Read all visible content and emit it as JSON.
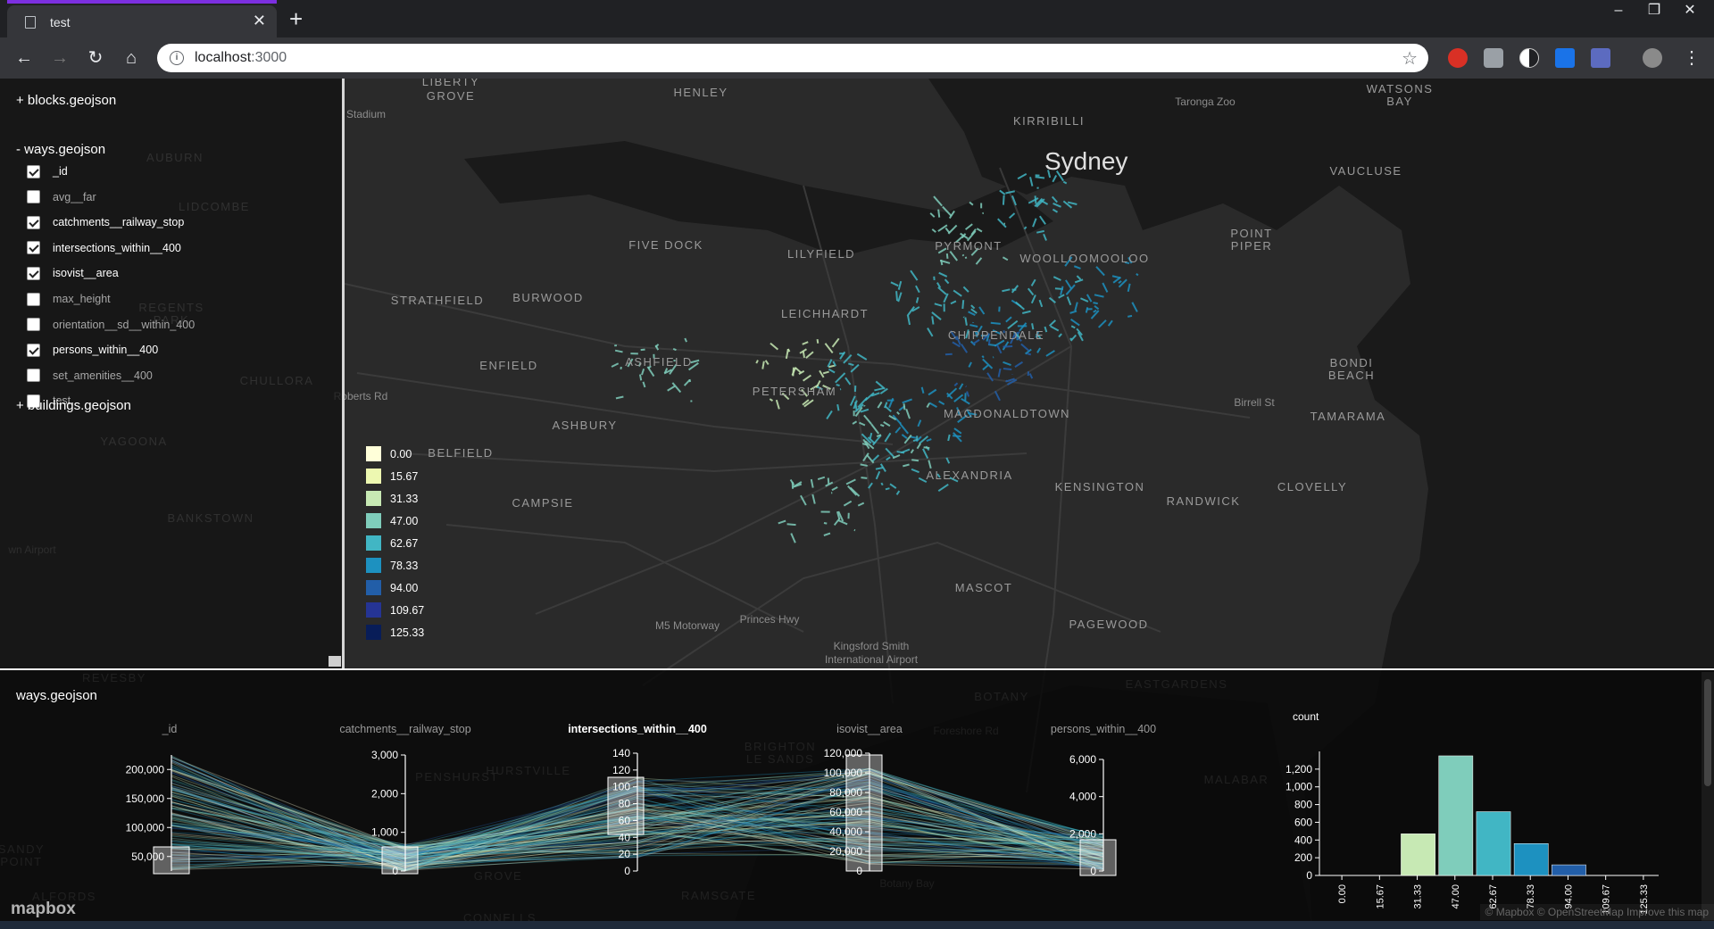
{
  "browser": {
    "tab_title": "test",
    "url_host": "localhost",
    "url_port": ":3000",
    "accent_color": "#7c2fe0"
  },
  "map": {
    "city_label": "Sydney",
    "place_labels": [
      {
        "text": "HENLEY",
        "cls": "sub"
      },
      {
        "text": "KIRRIBILLI",
        "cls": "sub"
      },
      {
        "text": "Taronga Zoo",
        "cls": "poi"
      },
      {
        "text": "WATSONS",
        "cls": "sub"
      },
      {
        "text": "BAY",
        "cls": "sub"
      },
      {
        "text": "VAUCLUSE",
        "cls": "sub"
      },
      {
        "text": "POINT",
        "cls": "sub"
      },
      {
        "text": "PIPER",
        "cls": "sub"
      },
      {
        "text": "FIVE DOCK",
        "cls": "sub"
      },
      {
        "text": "PYRMONT",
        "cls": "sub"
      },
      {
        "text": "WOOLLOOMOOLOO",
        "cls": "sub"
      },
      {
        "text": "LILYFIELD",
        "cls": "sub"
      },
      {
        "text": "STRATHFIELD",
        "cls": "sub"
      },
      {
        "text": "BURWOOD",
        "cls": "sub"
      },
      {
        "text": "LEICHHARDT",
        "cls": "sub"
      },
      {
        "text": "CHIPPENDALE",
        "cls": "sub"
      },
      {
        "text": "BONDI",
        "cls": "sub"
      },
      {
        "text": "BEACH",
        "cls": "sub"
      },
      {
        "text": "ENFIELD",
        "cls": "sub"
      },
      {
        "text": "ASHFIELD",
        "cls": "sub"
      },
      {
        "text": "PETERSHAM",
        "cls": "sub"
      },
      {
        "text": "MACDONALDTOWN",
        "cls": "sub"
      },
      {
        "text": "Birrell St",
        "cls": "poi"
      },
      {
        "text": "TAMARAMA",
        "cls": "sub"
      },
      {
        "text": "ASHBURY",
        "cls": "sub"
      },
      {
        "text": "BELFIELD",
        "cls": "sub"
      },
      {
        "text": "ALEXANDRIA",
        "cls": "sub"
      },
      {
        "text": "KENSINGTON",
        "cls": "sub"
      },
      {
        "text": "RANDWICK",
        "cls": "sub"
      },
      {
        "text": "CLOVELLY",
        "cls": "sub"
      },
      {
        "text": "CAMPSIE",
        "cls": "sub"
      },
      {
        "text": "MASCOT",
        "cls": "sub"
      },
      {
        "text": "PAGEWOOD",
        "cls": "sub"
      },
      {
        "text": "M5 Motorway",
        "cls": "poi"
      },
      {
        "text": "Princes Hwy",
        "cls": "poi"
      },
      {
        "text": "Kingsford Smith",
        "cls": "poi"
      },
      {
        "text": "International Airport",
        "cls": "poi"
      },
      {
        "text": "Roberts Rd",
        "cls": "poi"
      },
      {
        "text": "Stadium",
        "cls": "poi"
      },
      {
        "text": "GROVE",
        "cls": "sub"
      },
      {
        "text": "AUBURN",
        "cls": "sub"
      },
      {
        "text": "LIDCOMBE",
        "cls": "sub"
      },
      {
        "text": "REGENTS",
        "cls": "sub"
      },
      {
        "text": "PARK",
        "cls": "sub"
      },
      {
        "text": "CHULLORA",
        "cls": "sub"
      },
      {
        "text": "YAGOONA",
        "cls": "sub"
      },
      {
        "text": "BANKSTOWN",
        "cls": "sub"
      },
      {
        "text": "wn Airport",
        "cls": "poi"
      },
      {
        "text": "BOTANY",
        "cls": "sub"
      },
      {
        "text": "EASTGARDENS",
        "cls": "sub"
      },
      {
        "text": "MALABAR",
        "cls": "sub"
      },
      {
        "text": "HURSTVILLE",
        "cls": "sub"
      },
      {
        "text": "BRIGHTON",
        "cls": "sub"
      },
      {
        "text": "LE SANDS",
        "cls": "sub"
      },
      {
        "text": "RAMSGATE",
        "cls": "sub"
      },
      {
        "text": "Botany Bay",
        "cls": "poi"
      },
      {
        "text": "Foreshore Rd",
        "cls": "poi"
      },
      {
        "text": "REVESBY",
        "cls": "sub"
      },
      {
        "text": "SANDY",
        "cls": "sub"
      },
      {
        "text": "POINT",
        "cls": "sub"
      },
      {
        "text": "ALFORDS",
        "cls": "sub"
      },
      {
        "text": "PENSHURST",
        "cls": "sub"
      },
      {
        "text": "GROVE",
        "cls": "sub"
      },
      {
        "text": "CONNELLS",
        "cls": "sub"
      },
      {
        "text": "LIBERTY",
        "cls": "sub"
      }
    ]
  },
  "sidebar": {
    "blocks_header": "+ blocks.geojson",
    "ways_header": "- ways.geojson",
    "buildings_header": "+ buildings.geojson",
    "ways_items": [
      {
        "label": "_id",
        "checked": true
      },
      {
        "label": "avg__far",
        "checked": false
      },
      {
        "label": "catchments__railway_stop",
        "checked": true
      },
      {
        "label": "intersections_within__400",
        "checked": true
      },
      {
        "label": "isovist__area",
        "checked": true
      },
      {
        "label": "max_height",
        "checked": false
      },
      {
        "label": "orientation__sd__within_400",
        "checked": false
      },
      {
        "label": "persons_within__400",
        "checked": true
      },
      {
        "label": "set_amenities__400",
        "checked": false
      },
      {
        "label": "test",
        "checked": false
      }
    ]
  },
  "legend": [
    {
      "label": "0.00",
      "color": "#ffffd9"
    },
    {
      "label": "15.67",
      "color": "#edf8b1"
    },
    {
      "label": "31.33",
      "color": "#c7e9b4"
    },
    {
      "label": "47.00",
      "color": "#7fcdbb"
    },
    {
      "label": "62.67",
      "color": "#41b6c4"
    },
    {
      "label": "78.33",
      "color": "#1d91c0"
    },
    {
      "label": "94.00",
      "color": "#225ea8"
    },
    {
      "label": "109.67",
      "color": "#253494"
    },
    {
      "label": "125.33",
      "color": "#081d58"
    }
  ],
  "bottom_panel": {
    "title": "ways.geojson",
    "axes": [
      {
        "name": "_id",
        "highlight": false,
        "ticks": [
          "200,000",
          "150,000",
          "100,000",
          "50,000"
        ]
      },
      {
        "name": "catchments__railway_stop",
        "highlight": false,
        "ticks": [
          "3,000",
          "2,000",
          "1,000",
          "0"
        ]
      },
      {
        "name": "intersections_within__400",
        "highlight": true,
        "ticks": [
          "140",
          "120",
          "100",
          "80",
          "60",
          "40",
          "20",
          "0"
        ]
      },
      {
        "name": "isovist__area",
        "highlight": false,
        "ticks": [
          "120,000",
          "100,000",
          "80,000",
          "60,000",
          "40,000",
          "20,000",
          "0"
        ]
      },
      {
        "name": "persons_within__400",
        "highlight": false,
        "ticks": [
          "6,000",
          "4,000",
          "2,000",
          "0"
        ]
      }
    ],
    "scrollbar": true
  },
  "chart_data": {
    "type": "bar",
    "title": "",
    "ylabel": "count",
    "xlabel": "",
    "categories": [
      "0.00",
      "15.67",
      "31.33",
      "47.00",
      "62.67",
      "78.33",
      "94.00",
      "109.67",
      "125.33"
    ],
    "values": [
      0,
      0,
      470,
      1350,
      720,
      360,
      120,
      0,
      0
    ],
    "colors": [
      "#ffffd9",
      "#edf8b1",
      "#c7e9b4",
      "#7fcdbb",
      "#41b6c4",
      "#1d91c0",
      "#225ea8",
      "#253494",
      "#081d58"
    ],
    "yticks": [
      "0",
      "200",
      "400",
      "600",
      "800",
      "1,000",
      "1,200"
    ],
    "ylim": [
      0,
      1400
    ],
    "grid": false
  },
  "footer": {
    "mapbox": "mapbox",
    "attribution": "© Mapbox © OpenStreetMap Improve this map"
  }
}
